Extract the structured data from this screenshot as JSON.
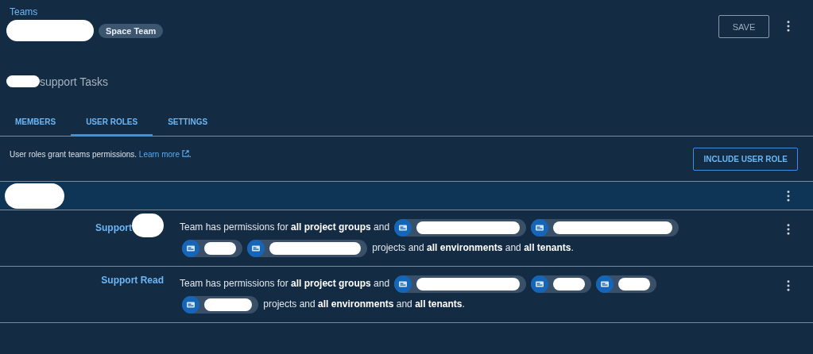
{
  "header": {
    "breadcrumb": "Teams",
    "title_redacted": true,
    "badge": "Space Team",
    "save_button": "SAVE"
  },
  "description": {
    "prefix_redacted": true,
    "text": "support Tasks"
  },
  "tabs": [
    {
      "label": "MEMBERS",
      "selected": false
    },
    {
      "label": "USER ROLES",
      "selected": true
    },
    {
      "label": "SETTINGS",
      "selected": false
    }
  ],
  "info": {
    "text": "User roles grant teams permissions.",
    "link": "Learn more",
    "end": "."
  },
  "include_button": "INCLUDE USER ROLE",
  "group": {
    "name_redacted": true
  },
  "roles": [
    {
      "name": "Support",
      "name_redacted": true,
      "lead": "Team has permissions for **all project groups** and",
      "projects": [
        {
          "redacted": true
        },
        {
          "redacted": true
        },
        {
          "redacted": true
        },
        {
          "redacted": true
        }
      ],
      "tail": "projects and **all environments** and **all tenants**."
    },
    {
      "name": "Support Read",
      "name_redacted": false,
      "lead": "Team has permissions for **all project groups** and",
      "projects": [
        {
          "redacted": true
        },
        {
          "redacted": true
        },
        {
          "redacted": true
        },
        {
          "redacted": true
        }
      ],
      "tail": "projects and **all environments** and **all tenants**."
    }
  ]
}
